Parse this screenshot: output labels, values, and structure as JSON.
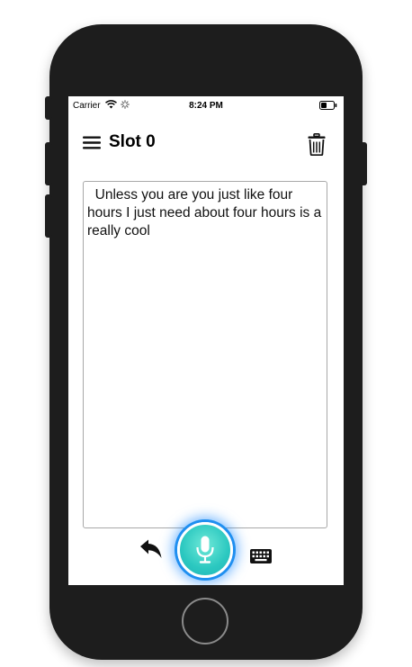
{
  "status_bar": {
    "carrier": "Carrier",
    "time": "8:24 PM",
    "icons": [
      "wifi-icon",
      "spinner-icon",
      "battery-icon"
    ]
  },
  "header": {
    "title": "Slot 0",
    "left_icon": "menu-icon",
    "right_icon": "trash-icon"
  },
  "transcript": {
    "text": "  Unless you are you just like four hours I just need about four hours is a really cool"
  },
  "toolbar": {
    "icons": [
      "undo-icon",
      "mic-icon",
      "keyboard-icon"
    ]
  },
  "colors": {
    "mic_fill": "#2bc8c0",
    "mic_glow": "#1f8ff0",
    "phone_body": "#1d1d1d"
  }
}
